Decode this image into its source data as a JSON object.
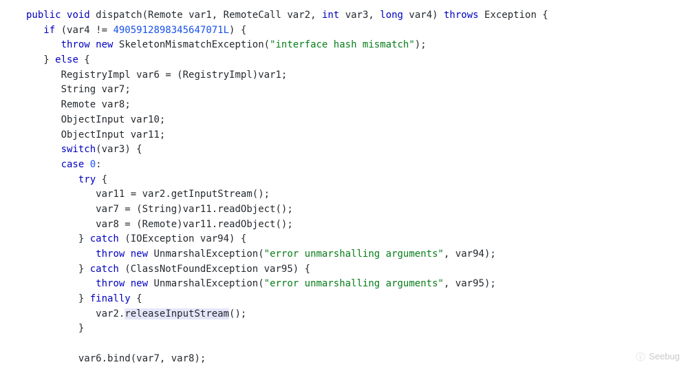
{
  "code": {
    "kw_public": "public",
    "kw_void": "void",
    "kw_int": "int",
    "kw_long": "long",
    "kw_throws": "throws",
    "kw_if": "if",
    "kw_else": "else",
    "kw_throw": "throw",
    "kw_new": "new",
    "kw_switch": "switch",
    "kw_case": "case",
    "kw_try": "try",
    "kw_catch": "catch",
    "kw_finally": "finally",
    "id_dispatch": "dispatch",
    "id_Remote": "Remote",
    "id_RemoteCall": "RemoteCall",
    "id_Exception": "Exception",
    "id_var1": "var1",
    "id_var2": "var2",
    "id_var3": "var3",
    "id_var4": "var4",
    "id_var6": "var6",
    "id_var7": "var7",
    "id_var8": "var8",
    "id_var10": "var10",
    "id_var11": "var11",
    "id_var94": "var94",
    "id_var95": "var95",
    "id_RegistryImpl": "RegistryImpl",
    "id_String": "String",
    "id_ObjectInput": "ObjectInput",
    "id_SkeletonMismatchException": "SkeletonMismatchException",
    "id_UnmarshalException": "UnmarshalException",
    "id_IOException": "IOException",
    "id_ClassNotFoundException": "ClassNotFoundException",
    "id_getInputStream": "getInputStream",
    "id_readObject": "readObject",
    "id_releaseInputStream": "releaseInputStream",
    "id_bind": "bind",
    "num_hash": "4905912898345647071L",
    "num_zero": "0",
    "str_interface_mismatch": "\"interface hash mismatch\"",
    "str_unmarshal_err": "\"error unmarshalling arguments\""
  },
  "watermark": {
    "text": "Seebug"
  }
}
